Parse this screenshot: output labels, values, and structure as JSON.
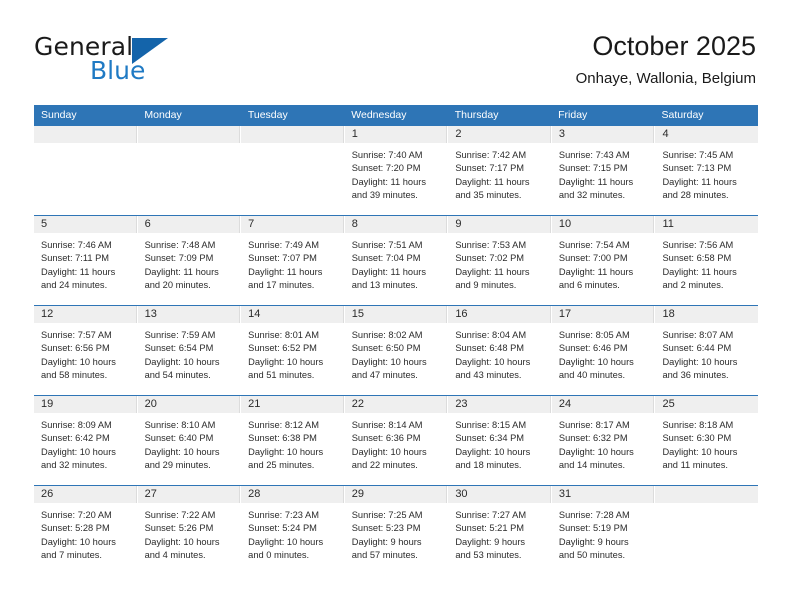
{
  "brand": {
    "name_top": "General",
    "name_bottom": "Blue",
    "triangle_icon": "triangle-icon",
    "color_dark": "#1a1a1a",
    "color_blue": "#1f7ac4"
  },
  "header": {
    "title": "October 2025",
    "subtitle": "Onhaye, Wallonia, Belgium"
  },
  "theme": {
    "header_bg": "#2e75b6",
    "header_text": "#ffffff",
    "daynum_band_bg": "#efefef",
    "row_separator": "#2e75b6",
    "body_text": "#2b2b2b"
  },
  "weekday_headers": [
    "Sunday",
    "Monday",
    "Tuesday",
    "Wednesday",
    "Thursday",
    "Friday",
    "Saturday"
  ],
  "weeks": [
    [
      {
        "day": "",
        "lines": []
      },
      {
        "day": "",
        "lines": []
      },
      {
        "day": "",
        "lines": []
      },
      {
        "day": "1",
        "lines": [
          "Sunrise: 7:40 AM",
          "Sunset: 7:20 PM",
          "Daylight: 11 hours",
          "and 39 minutes."
        ]
      },
      {
        "day": "2",
        "lines": [
          "Sunrise: 7:42 AM",
          "Sunset: 7:17 PM",
          "Daylight: 11 hours",
          "and 35 minutes."
        ]
      },
      {
        "day": "3",
        "lines": [
          "Sunrise: 7:43 AM",
          "Sunset: 7:15 PM",
          "Daylight: 11 hours",
          "and 32 minutes."
        ]
      },
      {
        "day": "4",
        "lines": [
          "Sunrise: 7:45 AM",
          "Sunset: 7:13 PM",
          "Daylight: 11 hours",
          "and 28 minutes."
        ]
      }
    ],
    [
      {
        "day": "5",
        "lines": [
          "Sunrise: 7:46 AM",
          "Sunset: 7:11 PM",
          "Daylight: 11 hours",
          "and 24 minutes."
        ]
      },
      {
        "day": "6",
        "lines": [
          "Sunrise: 7:48 AM",
          "Sunset: 7:09 PM",
          "Daylight: 11 hours",
          "and 20 minutes."
        ]
      },
      {
        "day": "7",
        "lines": [
          "Sunrise: 7:49 AM",
          "Sunset: 7:07 PM",
          "Daylight: 11 hours",
          "and 17 minutes."
        ]
      },
      {
        "day": "8",
        "lines": [
          "Sunrise: 7:51 AM",
          "Sunset: 7:04 PM",
          "Daylight: 11 hours",
          "and 13 minutes."
        ]
      },
      {
        "day": "9",
        "lines": [
          "Sunrise: 7:53 AM",
          "Sunset: 7:02 PM",
          "Daylight: 11 hours",
          "and 9 minutes."
        ]
      },
      {
        "day": "10",
        "lines": [
          "Sunrise: 7:54 AM",
          "Sunset: 7:00 PM",
          "Daylight: 11 hours",
          "and 6 minutes."
        ]
      },
      {
        "day": "11",
        "lines": [
          "Sunrise: 7:56 AM",
          "Sunset: 6:58 PM",
          "Daylight: 11 hours",
          "and 2 minutes."
        ]
      }
    ],
    [
      {
        "day": "12",
        "lines": [
          "Sunrise: 7:57 AM",
          "Sunset: 6:56 PM",
          "Daylight: 10 hours",
          "and 58 minutes."
        ]
      },
      {
        "day": "13",
        "lines": [
          "Sunrise: 7:59 AM",
          "Sunset: 6:54 PM",
          "Daylight: 10 hours",
          "and 54 minutes."
        ]
      },
      {
        "day": "14",
        "lines": [
          "Sunrise: 8:01 AM",
          "Sunset: 6:52 PM",
          "Daylight: 10 hours",
          "and 51 minutes."
        ]
      },
      {
        "day": "15",
        "lines": [
          "Sunrise: 8:02 AM",
          "Sunset: 6:50 PM",
          "Daylight: 10 hours",
          "and 47 minutes."
        ]
      },
      {
        "day": "16",
        "lines": [
          "Sunrise: 8:04 AM",
          "Sunset: 6:48 PM",
          "Daylight: 10 hours",
          "and 43 minutes."
        ]
      },
      {
        "day": "17",
        "lines": [
          "Sunrise: 8:05 AM",
          "Sunset: 6:46 PM",
          "Daylight: 10 hours",
          "and 40 minutes."
        ]
      },
      {
        "day": "18",
        "lines": [
          "Sunrise: 8:07 AM",
          "Sunset: 6:44 PM",
          "Daylight: 10 hours",
          "and 36 minutes."
        ]
      }
    ],
    [
      {
        "day": "19",
        "lines": [
          "Sunrise: 8:09 AM",
          "Sunset: 6:42 PM",
          "Daylight: 10 hours",
          "and 32 minutes."
        ]
      },
      {
        "day": "20",
        "lines": [
          "Sunrise: 8:10 AM",
          "Sunset: 6:40 PM",
          "Daylight: 10 hours",
          "and 29 minutes."
        ]
      },
      {
        "day": "21",
        "lines": [
          "Sunrise: 8:12 AM",
          "Sunset: 6:38 PM",
          "Daylight: 10 hours",
          "and 25 minutes."
        ]
      },
      {
        "day": "22",
        "lines": [
          "Sunrise: 8:14 AM",
          "Sunset: 6:36 PM",
          "Daylight: 10 hours",
          "and 22 minutes."
        ]
      },
      {
        "day": "23",
        "lines": [
          "Sunrise: 8:15 AM",
          "Sunset: 6:34 PM",
          "Daylight: 10 hours",
          "and 18 minutes."
        ]
      },
      {
        "day": "24",
        "lines": [
          "Sunrise: 8:17 AM",
          "Sunset: 6:32 PM",
          "Daylight: 10 hours",
          "and 14 minutes."
        ]
      },
      {
        "day": "25",
        "lines": [
          "Sunrise: 8:18 AM",
          "Sunset: 6:30 PM",
          "Daylight: 10 hours",
          "and 11 minutes."
        ]
      }
    ],
    [
      {
        "day": "26",
        "lines": [
          "Sunrise: 7:20 AM",
          "Sunset: 5:28 PM",
          "Daylight: 10 hours",
          "and 7 minutes."
        ]
      },
      {
        "day": "27",
        "lines": [
          "Sunrise: 7:22 AM",
          "Sunset: 5:26 PM",
          "Daylight: 10 hours",
          "and 4 minutes."
        ]
      },
      {
        "day": "28",
        "lines": [
          "Sunrise: 7:23 AM",
          "Sunset: 5:24 PM",
          "Daylight: 10 hours",
          "and 0 minutes."
        ]
      },
      {
        "day": "29",
        "lines": [
          "Sunrise: 7:25 AM",
          "Sunset: 5:23 PM",
          "Daylight: 9 hours",
          "and 57 minutes."
        ]
      },
      {
        "day": "30",
        "lines": [
          "Sunrise: 7:27 AM",
          "Sunset: 5:21 PM",
          "Daylight: 9 hours",
          "and 53 minutes."
        ]
      },
      {
        "day": "31",
        "lines": [
          "Sunrise: 7:28 AM",
          "Sunset: 5:19 PM",
          "Daylight: 9 hours",
          "and 50 minutes."
        ]
      },
      {
        "day": "",
        "lines": []
      }
    ]
  ]
}
